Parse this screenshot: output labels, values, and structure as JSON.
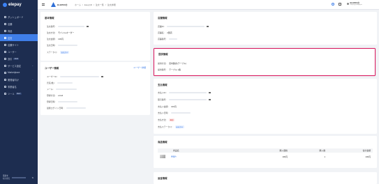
{
  "brand": {
    "name": "elepay",
    "accent": "#3f7ee8",
    "sidebar_bg": "#1d2d50"
  },
  "sidebar": {
    "items": [
      {
        "label": "ダッシュボード",
        "icon": "dashboard-icon"
      },
      {
        "label": "店舗",
        "icon": "store-icon"
      },
      {
        "label": "商品",
        "icon": "product-icon"
      },
      {
        "label": "注文",
        "icon": "order-icon",
        "active": true
      },
      {
        "label": "店舗サイト",
        "icon": "site-icon"
      },
      {
        "label": "ユーザー",
        "icon": "user-icon"
      },
      {
        "label": "割引",
        "icon": "discount-icon",
        "badge": "NEW"
      },
      {
        "label": "サービス設定",
        "icon": "settings-icon",
        "caret": "⌄"
      },
      {
        "label": "Marketplace",
        "icon": "marketplace-icon"
      },
      {
        "label": "開発者向け",
        "icon": "developer-icon",
        "caret": "⌄"
      },
      {
        "label": "事業者名",
        "icon": "business-icon"
      },
      {
        "label": "ツール",
        "icon": "tool-icon",
        "badge": "NEW"
      }
    ],
    "footer": {
      "line1": "環境を",
      "line2": "切り替え",
      "btn": "⇅"
    }
  },
  "header": {
    "app_name": "ELEPAYの",
    "breadcrumb": [
      "ホーム",
      "/",
      "EasyQR",
      "/",
      "注文一覧",
      "/",
      "注文詳細"
    ],
    "user_name": "ELEPAYの",
    "user_email": "elepay@elepay.io"
  },
  "order_card": {
    "title": "基本情報",
    "rows": [
      {
        "label": "注文番号 :"
      },
      {
        "label": "注文方法 :",
        "value": "モバイルオーダー"
      },
      {
        "label": "注文金額 :",
        "value": "100円"
      },
      {
        "label": "注文日時 :"
      },
      {
        "label": "ステータス :",
        "badge": "支払済み"
      }
    ]
  },
  "user_card": {
    "title": "ユーザー情報",
    "link": "ユーザー詳細",
    "rows": [
      {
        "label": "ユーザーID :"
      },
      {
        "label": "氏名(姓) :"
      },
      {
        "label": "メール :"
      },
      {
        "label": "登録方法 :",
        "value": "email"
      },
      {
        "label": "登録日時 :"
      },
      {
        "label": "最終ログイン日時 :"
      }
    ]
  },
  "store_card": {
    "title": "店舗情報",
    "rows": [
      {
        "label": "店舗ID :"
      },
      {
        "label": "店舗名 :",
        "value": "2部店"
      },
      {
        "label": "店舗番号 :"
      }
    ]
  },
  "pickup_card": {
    "title": "提供情報",
    "rows": [
      {
        "label": "提供方法 :",
        "value": "店内飲食(テーブル)"
      },
      {
        "label": "提供番号 :",
        "value": "テーブル 1番"
      }
    ]
  },
  "payment_card": {
    "title": "支払情報",
    "rows": [
      {
        "label": "支払いID :"
      },
      {
        "label": "取引番号 :"
      },
      {
        "label": "支払い金額 :",
        "value": "100円"
      },
      {
        "label": "支払い日時 :"
      },
      {
        "label": "支払方法 :",
        "badge": "現金"
      },
      {
        "label": "支払ステータス :",
        "badge": "支払済み"
      }
    ]
  },
  "products_card": {
    "title": "商品情報",
    "columns": [
      "商品名",
      "購入価格",
      "購入数",
      "合計金額"
    ],
    "rows": [
      {
        "name": "商品A",
        "price": "100円",
        "qty": "1",
        "total": "100円"
      }
    ]
  },
  "footer_card": {
    "title": "返金情報"
  }
}
